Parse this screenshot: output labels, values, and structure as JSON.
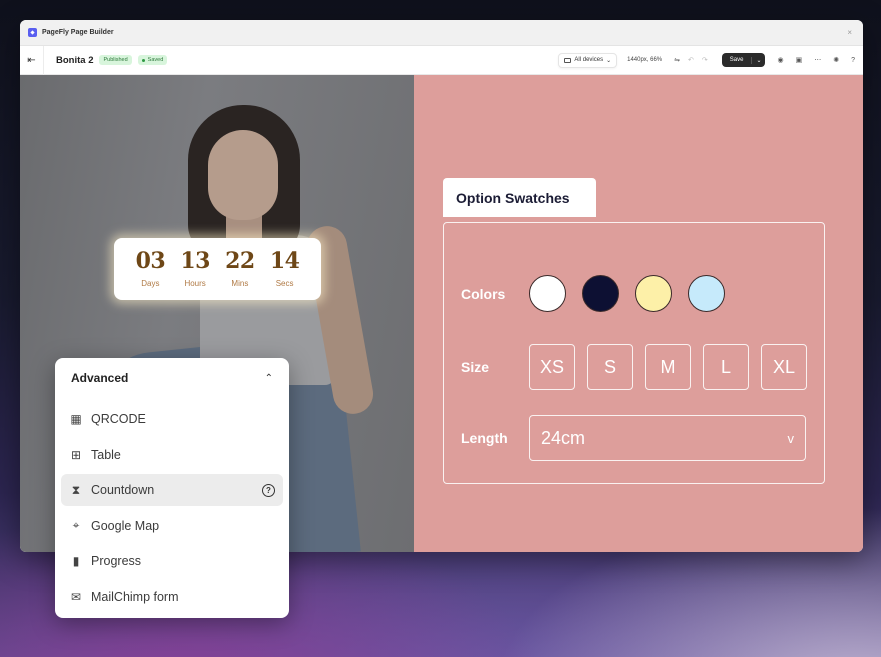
{
  "window": {
    "app_title": "PageFly Page Builder",
    "close_glyph": "×"
  },
  "toolbar": {
    "exit_icon": "⇤",
    "page_name": "Bonita 2",
    "published_badge": "Published",
    "saved_badge": "Saved",
    "device_select": "All devices",
    "viewport_readout": "1440px, 66%",
    "save_label": "Save",
    "icons": {
      "settings_sliders": "⇋",
      "undo": "↶",
      "redo": "↷",
      "save_chevron": "⌄",
      "preview": "◉",
      "layout": "▣",
      "more": "⋯",
      "gear": "✺",
      "help": "?"
    }
  },
  "countdown": {
    "units": [
      {
        "value": "03",
        "label": "Days"
      },
      {
        "value": "13",
        "label": "Hours"
      },
      {
        "value": "22",
        "label": "Mins"
      },
      {
        "value": "14",
        "label": "Secs"
      }
    ],
    "number_color": "#6e4717",
    "label_color": "#b07a45"
  },
  "swatches": {
    "tab_title": "Option Swatches",
    "colors_label": "Colors",
    "colors": [
      "#ffffff",
      "#0d1033",
      "#fdf0a8",
      "#c6eafb"
    ],
    "size_label": "Size",
    "sizes": [
      "XS",
      "S",
      "M",
      "L",
      "XL"
    ],
    "length_label": "Length",
    "length_value": "24cm",
    "length_chevron": "v",
    "background": "#dd9e9b"
  },
  "panel": {
    "title": "Advanced",
    "collapse_icon": "⌃",
    "items": [
      {
        "label": "QRCODE",
        "icon": "▦",
        "icon_name": "qrcode-icon"
      },
      {
        "label": "Table",
        "icon": "⊞",
        "icon_name": "table-icon"
      },
      {
        "label": "Countdown",
        "icon": "⧗",
        "icon_name": "hourglass-icon",
        "active": true,
        "help": "?"
      },
      {
        "label": "Google Map",
        "icon": "⌖",
        "icon_name": "map-pin-icon"
      },
      {
        "label": "Progress",
        "icon": "▮",
        "icon_name": "bar-chart-icon"
      },
      {
        "label": "MailChimp form",
        "icon": "✉",
        "icon_name": "mailbox-icon"
      }
    ]
  }
}
